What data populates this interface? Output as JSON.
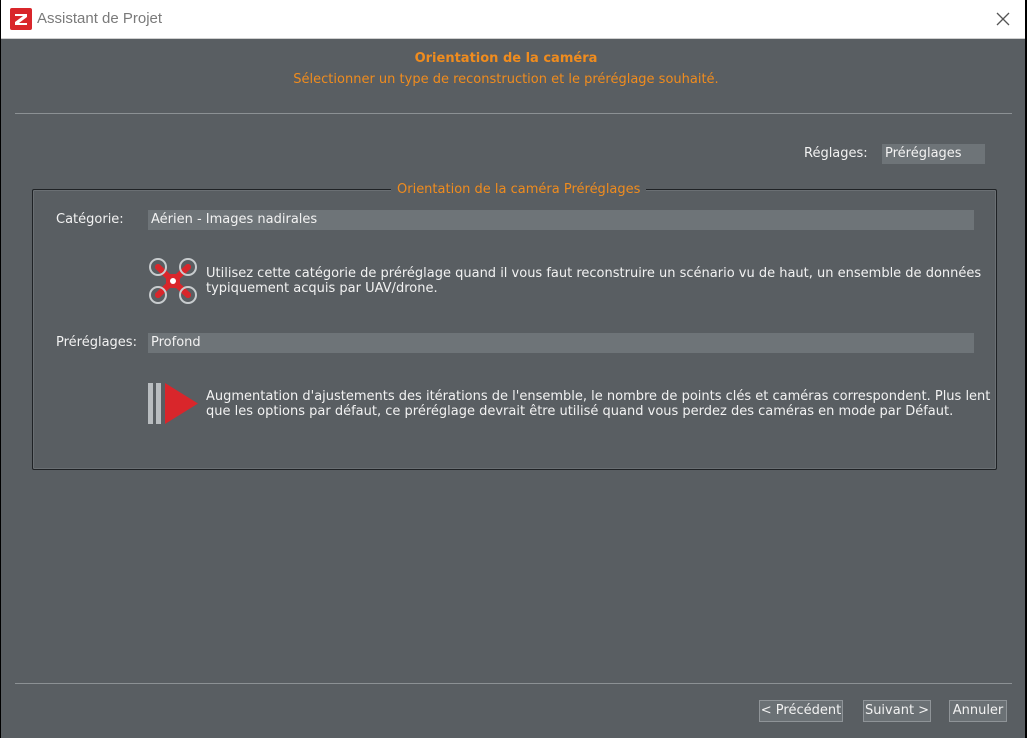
{
  "window": {
    "title": "Assistant de Projet"
  },
  "header": {
    "title": "Orientation de la caméra",
    "subtitle": "Sélectionner un type de reconstruction et le préréglage souhaité."
  },
  "settings": {
    "label": "Réglages:",
    "value": "Préréglages"
  },
  "group": {
    "title": "Orientation de la caméra Préréglages",
    "category_label": "Catégorie:",
    "category_value": "Aérien - Images nadirales",
    "category_description_line1": "Utilisez cette catégorie de préréglage quand il vous faut reconstruire un scénario vu de haut, un ensemble de données",
    "category_description_line2": "typiquement acquis par UAV/drone.",
    "preset_label": "Préréglages:",
    "preset_value": "Profond",
    "preset_description_line1": "Augmentation d'ajustements des itérations de l'ensemble, le nombre de points clés et caméras correspondent. Plus lent",
    "preset_description_line2": "que les options par défaut, ce préréglage devrait être utilisé quand vous perdez des caméras en mode par Défaut."
  },
  "footer": {
    "previous_label": "< Précédent",
    "next_label": "Suivant >",
    "cancel_label": "Annuler"
  },
  "colors": {
    "accent": "#f08c1e",
    "background": "#595e62",
    "icon_red": "#d9262b"
  },
  "icons": {
    "category": "drone-icon",
    "preset": "play-arrow-icon",
    "close": "close-icon",
    "app": "app-logo-icon"
  }
}
